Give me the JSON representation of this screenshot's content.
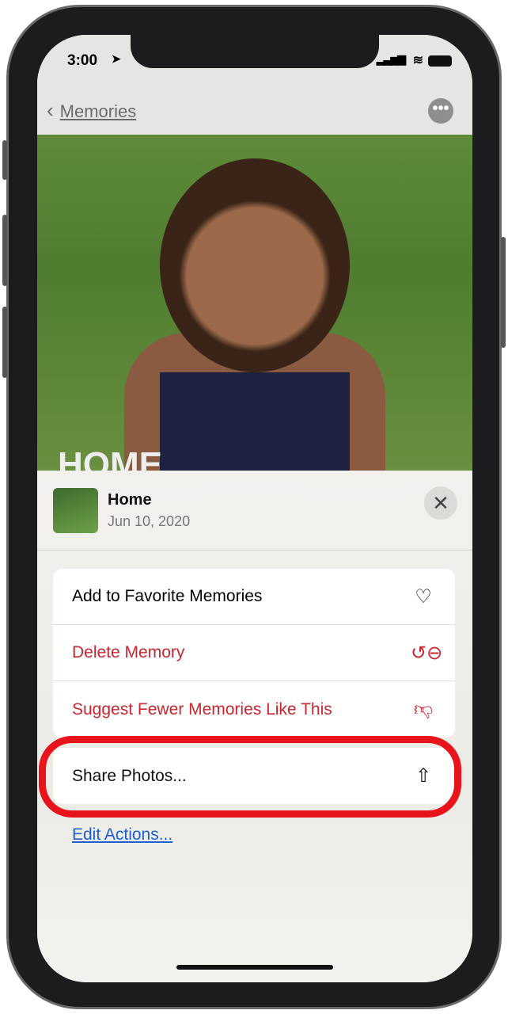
{
  "status": {
    "time": "3:00"
  },
  "nav": {
    "back_label": "Memories",
    "more_icon": "ellipsis-circle-icon"
  },
  "photo": {
    "overlay_title": "HOME"
  },
  "sheet": {
    "title": "Home",
    "date": "Jun 10, 2020",
    "actions": [
      {
        "label": "Add to Favorite Memories",
        "icon": "heart-icon",
        "color": "#111111"
      },
      {
        "label": "Delete Memory",
        "icon": "delete-memory-icon",
        "color": "#c9262f"
      },
      {
        "label": "Suggest Fewer Memories Like This",
        "icon": "thumbs-down-icon",
        "color": "#c9262f"
      }
    ],
    "share_label": "Share Photos...",
    "edit_actions_label": "Edit Actions...",
    "highlight_color": "#e8141c"
  }
}
